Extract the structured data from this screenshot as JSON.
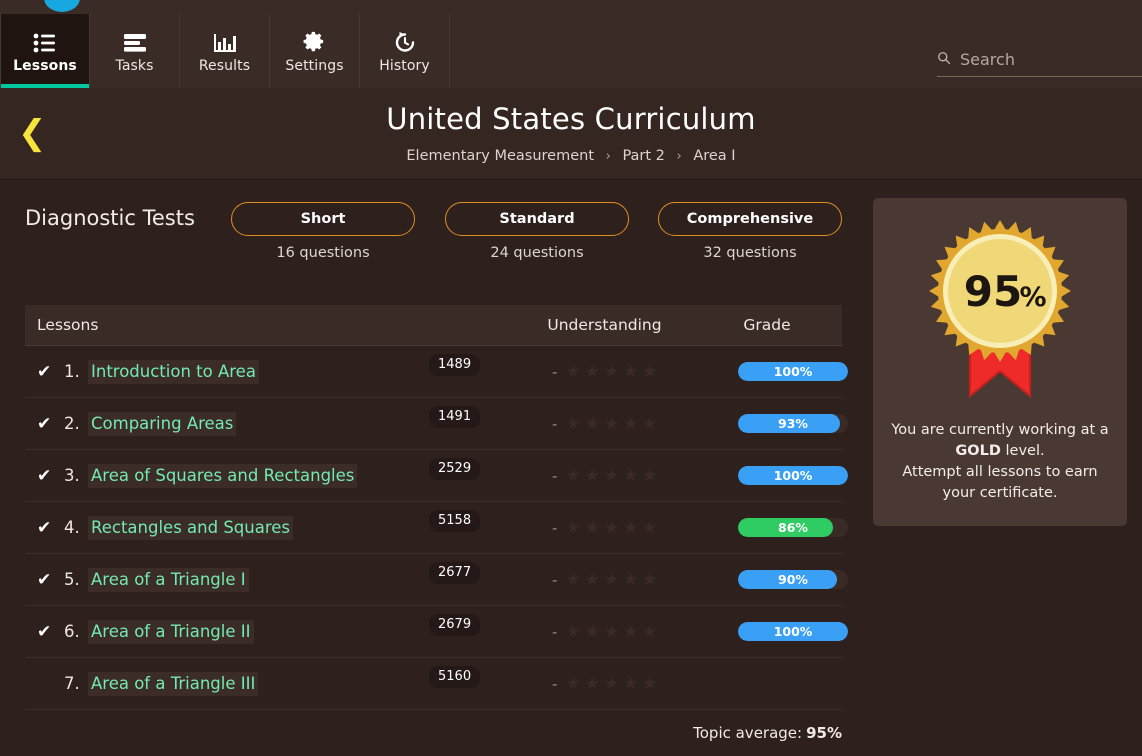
{
  "brand": {
    "logo_icon": "circle-logo",
    "accent_teal": "#00c9a0",
    "accent_yellow": "#f5e53b",
    "accent_orange": "#e08e22"
  },
  "nav": {
    "tabs": [
      {
        "label": "Lessons",
        "icon": "list-icon",
        "active": true
      },
      {
        "label": "Tasks",
        "icon": "tasks-icon",
        "active": false
      },
      {
        "label": "Results",
        "icon": "bar-chart-icon",
        "active": false
      },
      {
        "label": "Settings",
        "icon": "gear-icon",
        "active": false
      },
      {
        "label": "History",
        "icon": "history-icon",
        "active": false
      }
    ]
  },
  "search": {
    "placeholder": "Search",
    "value": "",
    "icon": "search-icon"
  },
  "header": {
    "back_icon": "chevron-left-icon",
    "title": "United States Curriculum",
    "breadcrumb": [
      "Elementary Measurement",
      "Part 2",
      "Area I"
    ],
    "separator": "›"
  },
  "diagnostics": {
    "label": "Diagnostic Tests",
    "tests": [
      {
        "name": "Short",
        "questions": "16 questions"
      },
      {
        "name": "Standard",
        "questions": "24 questions"
      },
      {
        "name": "Comprehensive",
        "questions": "32 questions"
      }
    ]
  },
  "table": {
    "columns": {
      "lessons": "Lessons",
      "understanding": "Understanding",
      "grade": "Grade"
    },
    "check_glyph": "✔",
    "dash": "-",
    "star_glyph": "★",
    "star_count": 5,
    "rows": [
      {
        "checked": true,
        "num": "1.",
        "name": "Introduction to Area",
        "id": "1489",
        "stars": 0,
        "grade": "100%",
        "grade_value": 100,
        "grade_color": "#3aa0f5"
      },
      {
        "checked": true,
        "num": "2.",
        "name": "Comparing Areas",
        "id": "1491",
        "stars": 0,
        "grade": "93%",
        "grade_value": 93,
        "grade_color": "#3aa0f5"
      },
      {
        "checked": true,
        "num": "3.",
        "name": "Area of Squares and Rectangles",
        "id": "2529",
        "stars": 0,
        "grade": "100%",
        "grade_value": 100,
        "grade_color": "#3aa0f5"
      },
      {
        "checked": true,
        "num": "4.",
        "name": "Rectangles and Squares",
        "id": "5158",
        "stars": 0,
        "grade": "86%",
        "grade_value": 86,
        "grade_color": "#2ecc63"
      },
      {
        "checked": true,
        "num": "5.",
        "name": "Area of a Triangle I",
        "id": "2677",
        "stars": 0,
        "grade": "90%",
        "grade_value": 90,
        "grade_color": "#3aa0f5"
      },
      {
        "checked": true,
        "num": "6.",
        "name": "Area of a Triangle II",
        "id": "2679",
        "stars": 0,
        "grade": "100%",
        "grade_value": 100,
        "grade_color": "#3aa0f5"
      },
      {
        "checked": false,
        "num": "7.",
        "name": "Area of a Triangle III",
        "id": "5160",
        "stars": 0,
        "grade": "",
        "grade_value": 0,
        "grade_color": "#3aa0f5"
      }
    ],
    "footer_label": "Topic average:",
    "footer_value": "95%"
  },
  "award": {
    "badge_icon": "award-ribbon-icon",
    "percent": "95",
    "percent_symbol": "%",
    "line1_before": "You are currently working at a ",
    "level": "GOLD",
    "line1_after": " level.",
    "line2": "Attempt all lessons to earn your certificate.",
    "colors": {
      "burst": "#e2a72f",
      "disc": "#f0d878",
      "ring": "#f8eeb8",
      "ribbon": "#ee2b28"
    }
  }
}
